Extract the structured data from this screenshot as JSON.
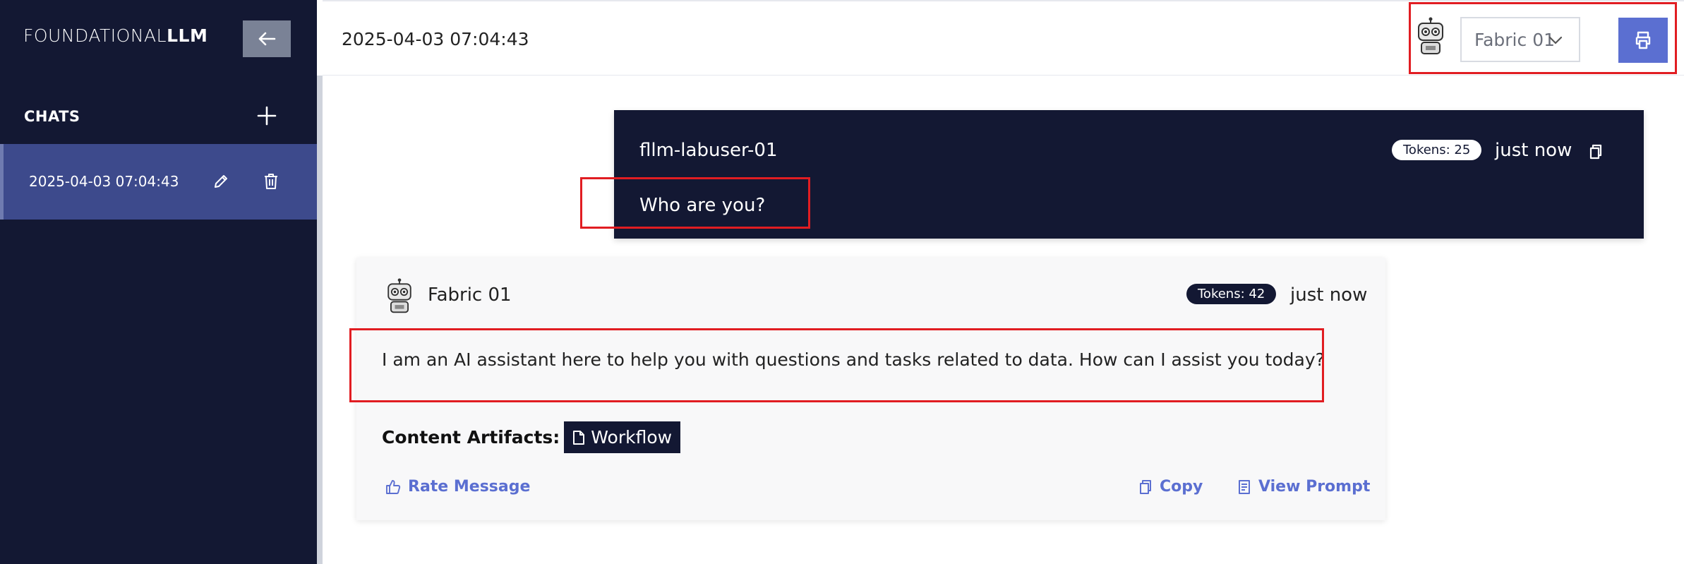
{
  "sidebar": {
    "brand_light": "FOUNDATIONAL",
    "brand_bold": "LLM",
    "chats_label": "CHATS",
    "chats": [
      {
        "label": "2025-04-03 07:04:43"
      }
    ]
  },
  "header": {
    "session_title": "2025-04-03 07:04:43",
    "agent_select": "Fabric 01"
  },
  "messages": [
    {
      "sender": "fllm-labuser-01",
      "tokens": "Tokens: 25",
      "time": "just now",
      "text": "Who are you?"
    },
    {
      "sender": "Fabric 01",
      "tokens": "Tokens: 42",
      "time": "just now",
      "text": "I am an AI assistant here to help you with questions and tasks related to data. How can I assist you today?",
      "artifacts_label": "Content Artifacts:",
      "artifact": "Workflow",
      "rate_label": "Rate Message",
      "copy_label": "Copy",
      "view_prompt_label": "View Prompt"
    }
  ],
  "colors": {
    "sidebar_bg": "#131833",
    "accent": "#5b6fd1",
    "active_chat": "#3d4a8c",
    "annotation": "#e11d22"
  },
  "icons": {
    "collapse": "arrow-left-icon",
    "add": "plus-icon",
    "edit": "pencil-icon",
    "delete": "trash-icon",
    "print": "printer-icon",
    "copy": "copy-icon",
    "rate": "thumbs-up-icon",
    "prompt": "document-lines-icon",
    "artifact": "file-icon"
  }
}
